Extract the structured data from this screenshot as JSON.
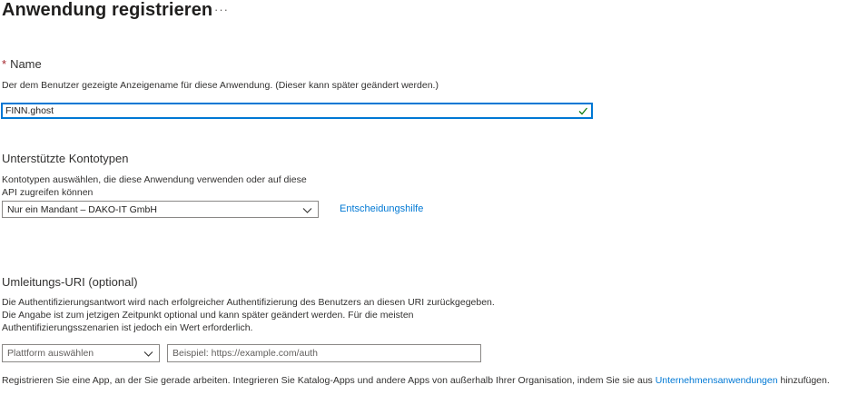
{
  "page": {
    "title": "Anwendung registrieren",
    "more_label": "···"
  },
  "name_section": {
    "required_marker": "*",
    "label": "Name",
    "description": "Der dem Benutzer gezeigte Anzeigename für diese Anwendung. (Dieser kann später geändert werden.)",
    "input_value": "FINN.ghost",
    "valid_icon": "checkmark-icon"
  },
  "account_types": {
    "label": "Unterstützte Kontotypen",
    "description_line1": "Kontotypen auswählen, die diese Anwendung verwenden oder auf diese",
    "description_line2": "API zugreifen können",
    "selected": "Nur ein Mandant – DAKO-IT GmbH",
    "help_link": "Entscheidungshilfe"
  },
  "redirect_uri": {
    "label": "Umleitungs-URI (optional)",
    "description_line1": "Die Authentifizierungsantwort wird nach erfolgreicher Authentifizierung des Benutzers an diesen URI zurückgegeben.",
    "description_line2": "Die Angabe ist zum jetzigen Zeitpunkt optional und kann später geändert werden. Für die meisten",
    "description_line3": "Authentifizierungsszenarien ist jedoch ein Wert erforderlich.",
    "platform_placeholder": "Plattform auswählen",
    "uri_placeholder": "Beispiel: https://example.com/auth"
  },
  "footer": {
    "text_before": "Registrieren Sie eine App, an der Sie gerade arbeiten. Integrieren Sie Katalog-Apps und andere Apps von außerhalb Ihrer Organisation, indem Sie sie aus ",
    "link": "Unternehmensanwendungen",
    "text_after": " hinzufügen."
  },
  "colors": {
    "accent": "#0078d4",
    "required": "#a4262c",
    "success": "#107c10"
  }
}
